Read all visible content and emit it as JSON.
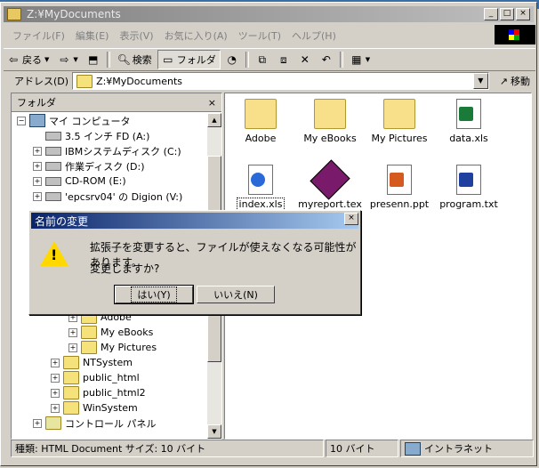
{
  "window": {
    "title": "Z:¥MyDocuments",
    "controls": [
      "_",
      "□",
      "×"
    ]
  },
  "menu": [
    "ファイル(F)",
    "編集(E)",
    "表示(V)",
    "お気に入り(A)",
    "ツール(T)",
    "ヘルプ(H)"
  ],
  "toolbar": {
    "back": "戻る",
    "search": "検索",
    "folders": "フォルダ"
  },
  "address": {
    "label": "アドレス(D)",
    "value": "Z:¥MyDocuments",
    "go": "移動"
  },
  "folders_pane": {
    "title": "フォルダ",
    "close": "×",
    "tree": [
      {
        "label": "マイ コンピュータ",
        "icon": "computer-icon"
      },
      {
        "label": "3.5 インチ FD (A:)",
        "icon": "floppy-icon"
      },
      {
        "label": "IBMシステムディスク (C:)",
        "icon": "drive-icon"
      },
      {
        "label": "作業ディスク (D:)",
        "icon": "drive-icon"
      },
      {
        "label": "CD-ROM (E:)",
        "icon": "cdrom-icon"
      },
      {
        "label": "'epcsrv04' の Digion (V:)",
        "icon": "network-drive-icon"
      },
      {
        "label": "Adobe",
        "icon": "folder-icon"
      },
      {
        "label": "My eBooks",
        "icon": "folder-icon"
      },
      {
        "label": "My Pictures",
        "icon": "folder-icon"
      },
      {
        "label": "NTSystem",
        "icon": "folder-icon"
      },
      {
        "label": "public_html",
        "icon": "folder-icon"
      },
      {
        "label": "public_html2",
        "icon": "folder-icon"
      },
      {
        "label": "WinSystem",
        "icon": "folder-icon"
      },
      {
        "label": "コントロール パネル",
        "icon": "control-panel-icon"
      }
    ]
  },
  "files": [
    {
      "name": "Adobe",
      "type": "folder"
    },
    {
      "name": "My eBooks",
      "type": "folder"
    },
    {
      "name": "My Pictures",
      "type": "folder"
    },
    {
      "name": "data.xls",
      "type": "excel"
    },
    {
      "name": "index.xls",
      "type": "ie"
    },
    {
      "name": "myreport.tex",
      "type": "tex"
    },
    {
      "name": "presenn.ppt",
      "type": "ppt"
    },
    {
      "name": "program.txt",
      "type": "txt"
    }
  ],
  "status": {
    "info": "種類: HTML Document サイズ: 10 バイト",
    "size": "10 バイト",
    "zone": "イントラネット"
  },
  "dialog": {
    "title": "名前の変更",
    "message": "拡張子を変更すると、ファイルが使えなくなる可能性があります。",
    "question": "変更しますか?",
    "yes": "はい(Y)",
    "no": "いいえ(N)"
  },
  "colors": {
    "dialog_title": "#0a246a",
    "window_bg": "#d4d0c8"
  }
}
